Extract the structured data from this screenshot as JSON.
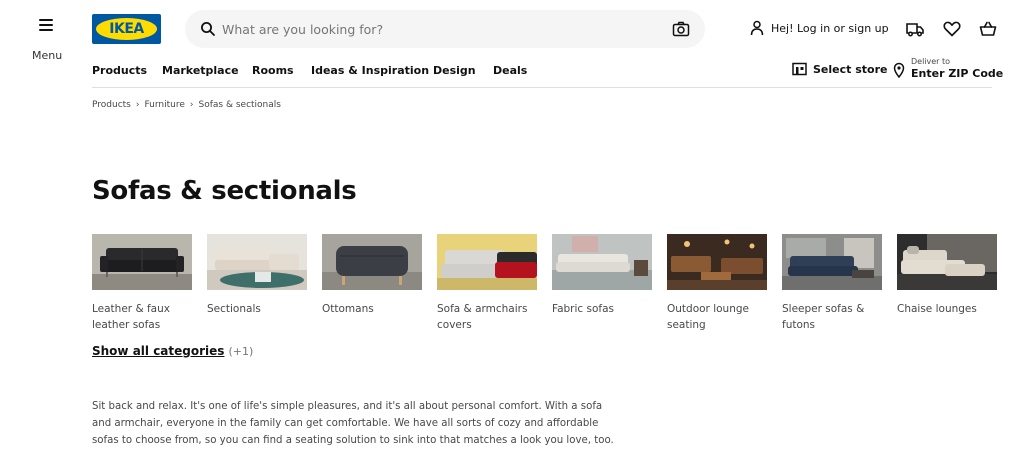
{
  "menu": {
    "label": "Menu"
  },
  "logo": {
    "text": "IKEA"
  },
  "search": {
    "placeholder": "What are you looking for?"
  },
  "account": {
    "login_label": "Hej! Log in or sign up"
  },
  "nav": {
    "items": [
      "Products",
      "Marketplace",
      "Rooms",
      "Ideas & Inspiration",
      "Design",
      "Deals"
    ],
    "select_store": "Select store",
    "deliver_to": "Deliver to",
    "zip": "Enter ZIP Code"
  },
  "breadcrumb": [
    "Products",
    "Furniture",
    "Sofas & sectionals"
  ],
  "page": {
    "title": "Sofas & sectionals"
  },
  "categories": [
    {
      "label": "Leather & faux leather sofas"
    },
    {
      "label": "Sectionals"
    },
    {
      "label": "Ottomans"
    },
    {
      "label": "Sofa & armchairs covers"
    },
    {
      "label": "Fabric sofas"
    },
    {
      "label": "Outdoor lounge seating"
    },
    {
      "label": "Sleeper sofas & futons"
    },
    {
      "label": "Chaise lounges"
    }
  ],
  "show_all": {
    "label": "Show all categories",
    "count": "(+1)"
  },
  "intro": "Sit back and relax. It's one of life's simple pleasures, and it's all about personal comfort. With a sofa and armchair, everyone in the family can get comfortable. We have all sorts of cozy and affordable sofas to choose from, so you can find a seating solution to sink into that matches a look you love, too.",
  "colors": {
    "brand_blue": "#0058a3",
    "brand_yellow": "#ffdb00",
    "text": "#111111",
    "muted": "#484848"
  }
}
